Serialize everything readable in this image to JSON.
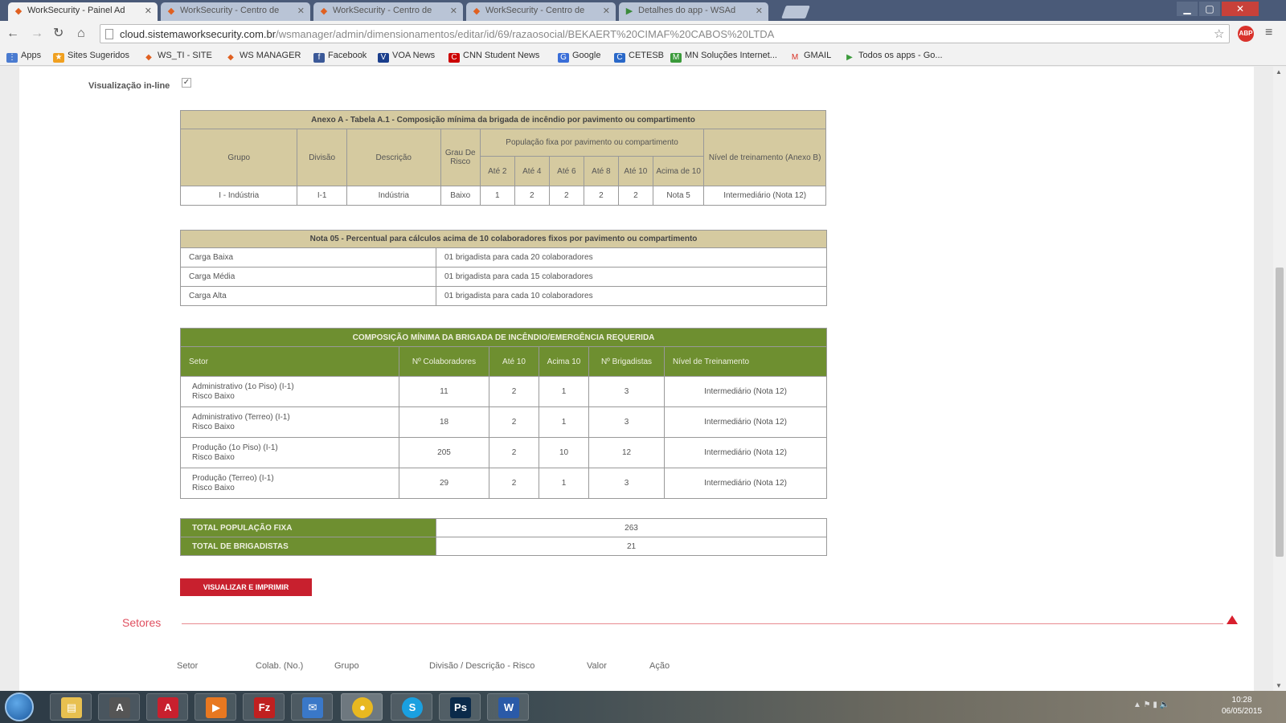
{
  "browser": {
    "tabs": [
      {
        "title": "WorkSecurity - Painel Ad",
        "active": true
      },
      {
        "title": "WorkSecurity - Centro de",
        "active": false
      },
      {
        "title": "WorkSecurity - Centro de",
        "active": false
      },
      {
        "title": "WorkSecurity - Centro de",
        "active": false
      },
      {
        "title": "Detalhes do app - WSAd",
        "active": false
      }
    ],
    "url_host": "cloud.sistemaworksecurity.com.br",
    "url_path": "/wsmanager/admin/dimensionamentos/editar/id/69/razaosocial/BEKAERT%20CIMAF%20CABOS%20LTDA",
    "profile_badge": "ABP",
    "bookmarks": [
      "Apps",
      "Sites Sugeridos",
      "WS_TI - SITE",
      "WS MANAGER",
      "Facebook",
      "VOA News",
      "CNN Student News",
      "Google",
      "CETESB",
      "MN Soluções Internet...",
      "GMAIL",
      "Todos os apps - Go..."
    ]
  },
  "page": {
    "visualizacao_label": "Visualização in-line",
    "table1": {
      "caption": "Anexo A - Tabela A.1 - Composição mínima da brigada de incêndio por pavimento ou compartimento",
      "headers": {
        "grupo": "Grupo",
        "divisao": "Divisão",
        "descricao": "Descrição",
        "grau": "Grau De Risco",
        "populacao": "População fixa por pavimento ou compartimento",
        "ate2": "Até 2",
        "ate4": "Até 4",
        "ate6": "Até 6",
        "ate8": "Até 8",
        "ate10": "Até 10",
        "acima10": "Acima de 10",
        "nivel": "Nível de treinamento (Anexo B)"
      },
      "row": {
        "grupo": "I - Indústria",
        "divisao": "I-1",
        "descricao": "Indústria",
        "grau": "Baixo",
        "ate2": "1",
        "ate4": "2",
        "ate6": "2",
        "ate8": "2",
        "ate10": "2",
        "acima10": "Nota 5",
        "nivel": "Intermediário (Nota 12)"
      }
    },
    "table2": {
      "caption": "Nota 05 - Percentual para cálculos acima de 10 colaboradores fixos por pavimento ou compartimento",
      "rows": [
        {
          "label": "Carga Baixa",
          "value": "01 brigadista para cada 20 colaboradores"
        },
        {
          "label": "Carga Média",
          "value": "01 brigadista para cada 15 colaboradores"
        },
        {
          "label": "Carga Alta",
          "value": "01 brigadista para cada 10 colaboradores"
        }
      ]
    },
    "table3": {
      "caption": "COMPOSIÇÃO MÍNIMA DA BRIGADA DE INCÊNDIO/EMERGÊNCIA REQUERIDA",
      "headers": {
        "setor": "Setor",
        "colaboradores": "Nº Colaboradores",
        "ate10": "Até 10",
        "acima10": "Acima 10",
        "brigadistas": "Nº Brigadistas",
        "nivel": "Nível de Treinamento"
      },
      "rows": [
        {
          "setor": "Administrativo (1o Piso) (I-1)",
          "risco": "Risco Baixo",
          "colaboradores": "11",
          "ate10": "2",
          "acima10": "1",
          "brigadistas": "3",
          "nivel": "Intermediário (Nota 12)"
        },
        {
          "setor": "Administrativo (Terreo) (I-1)",
          "risco": "Risco Baixo",
          "colaboradores": "18",
          "ate10": "2",
          "acima10": "1",
          "brigadistas": "3",
          "nivel": "Intermediário (Nota 12)"
        },
        {
          "setor": "Produção (1o Piso) (I-1)",
          "risco": "Risco Baixo",
          "colaboradores": "205",
          "ate10": "2",
          "acima10": "10",
          "brigadistas": "12",
          "nivel": "Intermediário (Nota 12)"
        },
        {
          "setor": "Produção (Terreo) (I-1)",
          "risco": "Risco Baixo",
          "colaboradores": "29",
          "ate10": "2",
          "acima10": "1",
          "brigadistas": "3",
          "nivel": "Intermediário (Nota 12)"
        }
      ]
    },
    "totals": {
      "populacao_label": "TOTAL POPULAÇÃO FIXA",
      "populacao_value": "263",
      "brigadistas_label": "TOTAL DE BRIGADISTAS",
      "brigadistas_value": "21"
    },
    "print_button": "VISUALIZAR E IMPRIMIR",
    "setores": {
      "title": "Setores",
      "columns": [
        "Setor",
        "Colab. (No.)",
        "Grupo",
        "Divisão / Descrição - Risco",
        "Valor",
        "Ação"
      ]
    }
  },
  "taskbar": {
    "apps": [
      "Explorer",
      "Acrobat Reader",
      "Acrobat",
      "Media Player",
      "FileZilla",
      "Thunderbird",
      "Chrome",
      "Skype",
      "Photoshop",
      "Word"
    ],
    "time": "10:28",
    "date": "06/05/2015"
  },
  "colors": {
    "khaki_header": "#d5caa0",
    "green_header": "#6e8f30",
    "accent_red": "#c8202e"
  }
}
